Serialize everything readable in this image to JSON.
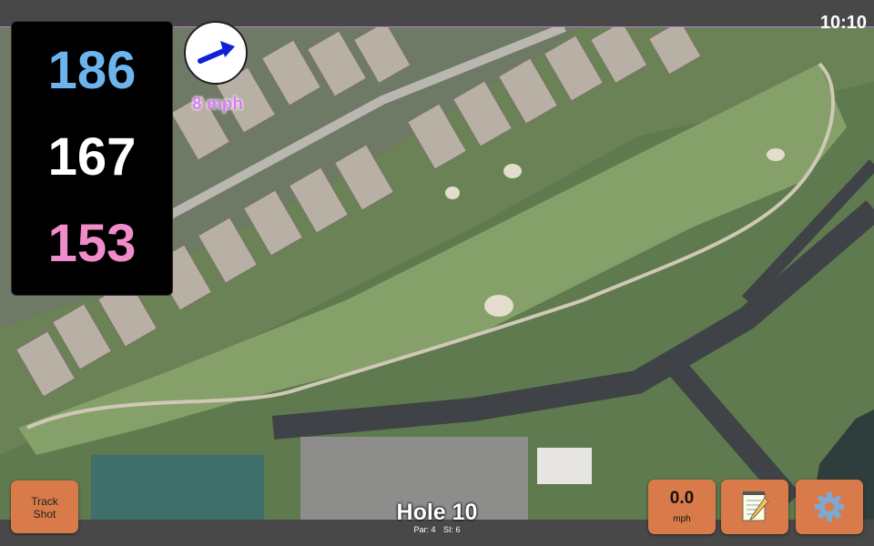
{
  "status": {
    "time": "10:10"
  },
  "distances": {
    "back": "186",
    "middle": "167",
    "front": "153"
  },
  "wind": {
    "speed": "8 mph",
    "direction_icon": "arrow-icon"
  },
  "buttons": {
    "track_shot": [
      "Track",
      "Shot"
    ],
    "speed_value": "0.0",
    "speed_unit": "mph",
    "notes_icon": "notepad-icon",
    "settings_icon": "gear-icon"
  },
  "hole": {
    "title": "Hole 10",
    "par": "Par: 4",
    "si": "SI: 6"
  },
  "colors": {
    "back": "#6cb4ee",
    "middle": "#ffffff",
    "front": "#f08cc8",
    "wind_text": "#d77bf0",
    "button": "#d97a4a"
  }
}
